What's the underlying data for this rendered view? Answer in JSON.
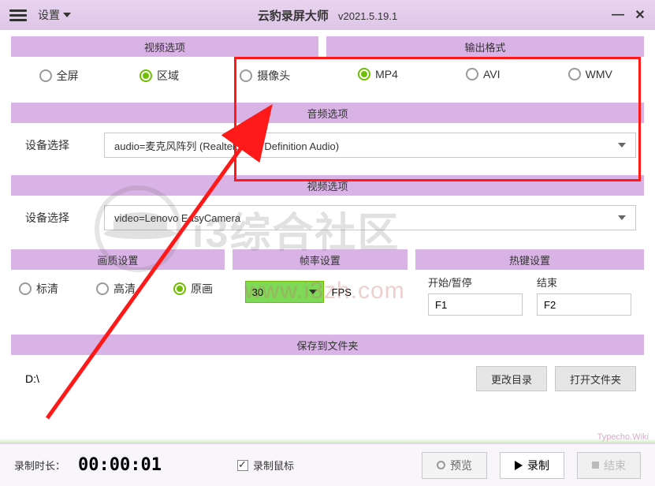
{
  "titlebar": {
    "settings_label": "设置",
    "app_title": "云豹录屏大师",
    "version": "v2021.5.19.1"
  },
  "video_options": {
    "header": "视频选项",
    "fullscreen": "全屏",
    "region": "区域",
    "camera": "摄像头",
    "selected": "区域"
  },
  "output_format": {
    "header": "输出格式",
    "mp4": "MP4",
    "avi": "AVI",
    "wmv": "WMV",
    "selected": "MP4"
  },
  "audio": {
    "header": "音频选项",
    "label": "设备选择",
    "value": "audio=麦克风阵列 (Realtek High Definition Audio)"
  },
  "video_device": {
    "header": "视频选项",
    "label": "设备选择",
    "value": "video=Lenovo EasyCamera"
  },
  "quality": {
    "header": "画质设置",
    "sd": "标清",
    "hd": "高清",
    "original": "原画",
    "selected": "原画"
  },
  "framerate": {
    "header": "帧率设置",
    "value": "30",
    "unit": "FPS"
  },
  "hotkeys": {
    "header": "热键设置",
    "start_pause_label": "开始/暂停",
    "start_pause_value": "F1",
    "stop_label": "结束",
    "stop_value": "F2"
  },
  "save": {
    "header": "保存到文件夹",
    "path": "D:\\",
    "change_btn": "更改目录",
    "open_btn": "打开文件夹"
  },
  "footer": {
    "time_label": "录制时长：",
    "time_value": "00:00:01",
    "record_mouse": "录制鼠标",
    "preview": "预览",
    "record": "录制",
    "stop": "结束"
  },
  "watermark": {
    "text": "i3综合社区",
    "url": "www.i3zh.com",
    "corner": "Typecho.Wiki"
  }
}
